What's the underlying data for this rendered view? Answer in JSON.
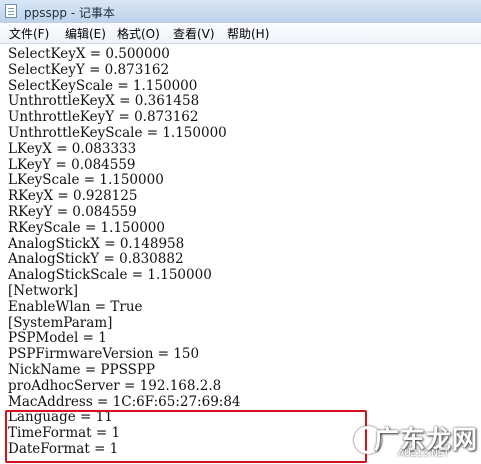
{
  "window": {
    "title": "ppsspp - 记事本"
  },
  "menu": {
    "items": [
      {
        "label": "文件(F)"
      },
      {
        "label": "编辑(E)"
      },
      {
        "label": "格式(O)"
      },
      {
        "label": "查看(V)"
      },
      {
        "label": "帮助(H)"
      }
    ]
  },
  "editor": {
    "lines": [
      "SelectKeyX = 0.500000",
      "SelectKeyY = 0.873162",
      "SelectKeyScale = 1.150000",
      "UnthrottleKeyX = 0.361458",
      "UnthrottleKeyY = 0.873162",
      "UnthrottleKeyScale = 1.150000",
      "LKeyX = 0.083333",
      "LKeyY = 0.084559",
      "LKeyScale = 1.150000",
      "RKeyX = 0.928125",
      "RKeyY = 0.084559",
      "RKeyScale = 1.150000",
      "AnalogStickX = 0.148958",
      "AnalogStickY = 0.830882",
      "AnalogStickScale = 1.150000",
      "[Network]",
      "EnableWlan = True",
      "[SystemParam]",
      "PSPModel = 1",
      "PSPFirmwareVersion = 150",
      "NickName = PPSSPP",
      "proAdhocServer = 192.168.2.8",
      "MacAddress = 1C:6F:65:27:69:84",
      "Language = 11",
      "TimeFormat = 1",
      "DateFormat = 1"
    ]
  },
  "watermark": {
    "main": "广东龙网",
    "sub": "AUZ13.NET"
  },
  "colors": {
    "highlight": "#d6121e"
  }
}
